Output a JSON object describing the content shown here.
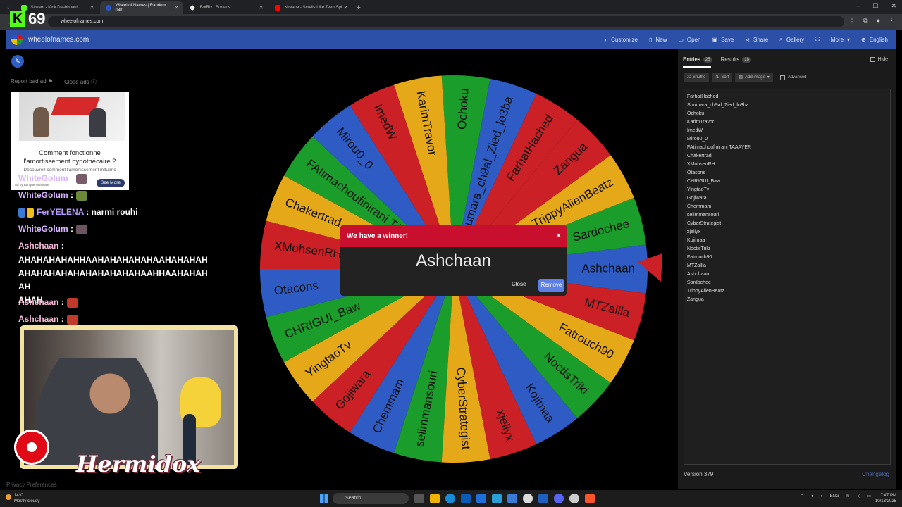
{
  "browser": {
    "tabs": [
      {
        "label": "Stream - Kick Dashboard",
        "color": "#53fc18",
        "active": false
      },
      {
        "label": "Wheel of Names | Random nam",
        "color": "#2a55c8",
        "active": true
      },
      {
        "label": "BotRix | Sorteos",
        "color": "#ffffff",
        "active": false
      },
      {
        "label": "Nirvana - Smells Like Teen Spi",
        "color": "#ff0000",
        "active": false
      }
    ],
    "url": "wheelofnames.com"
  },
  "overlay": {
    "logo_letter": "K",
    "viewer_count": "69"
  },
  "site": {
    "title": "wheelofnames.com",
    "menu": [
      "Customize",
      "New",
      "Open",
      "Save",
      "Share",
      "Gallery",
      "More",
      "English"
    ]
  },
  "left": {
    "report_ad": "Report bad ad",
    "close_ads": "Close ads",
    "ad": {
      "title": "Comment fonctionne l'amortissement hypothécaire ?",
      "subtitle": "Découvrez comment l'amortissement influenc",
      "source": "Ad by Banque Nationale",
      "button": "See More"
    },
    "chat": [
      {
        "user": "WhiteGolum",
        "sep": " :",
        "text": ""
      },
      {
        "user": "WhiteGolum",
        "sep": " :",
        "text": ""
      },
      {
        "user": "FerYELENA",
        "sep": " : ",
        "text": "narmi rouhi"
      },
      {
        "user": "WhiteGolum",
        "sep": " :",
        "text": ""
      },
      {
        "user": "Ashchaan",
        "sep": " :",
        "text": ""
      }
    ],
    "long_message": "AHAHAHAHAHHAAHAHAHAHAHAAHAHAHAHAHAHAHAHAHAHAHAHAHAHAAHHAAHAHAHAH",
    "long_message_end": "AHAH",
    "chat_after": [
      {
        "user": "Ashchaan",
        "sep": " :"
      },
      {
        "user": "Ashchaan",
        "sep": " :"
      }
    ],
    "streamer_name": "Hermidox",
    "privacy": "Privacy Preferences"
  },
  "wheel": {
    "colors": [
      "#cc2027",
      "#2e5cc4",
      "#1a9d2a",
      "#e5a819"
    ],
    "pointer_color": "#cc2027"
  },
  "modal": {
    "header": "We have a winner!",
    "close_x": "×",
    "winner": "Ashchaan",
    "close": "Close",
    "remove": "Remove"
  },
  "right": {
    "tab_entries": "Entries",
    "entries_count": "25",
    "tab_results": "Results",
    "results_count": "18",
    "hide": "Hide",
    "shuffle": "Shuffle",
    "sort": "Sort",
    "add_image": "Add image",
    "advanced": "Advanced",
    "entries": [
      "FarhatHached",
      "Soumara_ch9al_Zied_lo3ba",
      "Ochoku",
      "KarimTravor",
      "ImedW",
      "Mirou0_0",
      "FAtimachoufinirani TAAAYER",
      "Chakertrad",
      "XMohsenRH",
      "Otacons",
      "CHRIGUI_Baw",
      "YingtaoTv",
      "Gojiwara",
      "Chemmam",
      "selimmansouri",
      "CyberStrategist",
      "xjellyx",
      "Kojimaa",
      "NoctisTriki",
      "Fatrouch90",
      "MTZallla",
      "Ashchaan",
      "Sardochee",
      "TrippyAlienBeatz",
      "Zangua"
    ],
    "version": "Version 379",
    "changelog": "Changelog"
  },
  "taskbar": {
    "temp": "14°C",
    "weather": "Mostly cloudy",
    "search": "Search",
    "lang": "ENG",
    "time": "7:47 PM",
    "date": "10/13/2025"
  }
}
